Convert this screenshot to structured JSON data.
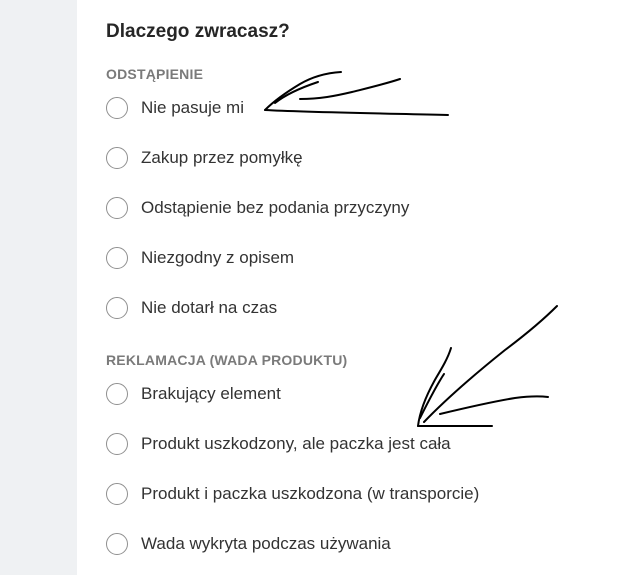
{
  "form": {
    "question": "Dlaczego zwracasz?",
    "sections": [
      {
        "heading": "ODSTĄPIENIE",
        "options": [
          {
            "label": "Nie pasuje mi",
            "selected": false
          },
          {
            "label": "Zakup przez pomyłkę",
            "selected": false
          },
          {
            "label": "Odstąpienie bez podania przyczyny",
            "selected": false
          },
          {
            "label": "Niezgodny z opisem",
            "selected": false
          },
          {
            "label": "Nie dotarł na czas",
            "selected": false
          }
        ]
      },
      {
        "heading": "REKLAMACJA (WADA PRODUKTU)",
        "options": [
          {
            "label": "Brakujący element",
            "selected": false
          },
          {
            "label": "Produkt uszkodzony, ale paczka jest cała",
            "selected": false
          },
          {
            "label": "Produkt i paczka uszkodzona (w transporcie)",
            "selected": false
          },
          {
            "label": "Wada wykryta podczas używania",
            "selected": false
          }
        ]
      }
    ]
  },
  "colors": {
    "background": "#ffffff",
    "side_strip": "#eff1f3",
    "heading_text": "#262626",
    "section_text": "#7a7a7a",
    "radio_border": "#8f8f8f",
    "annotation_ink": "#000000"
  }
}
